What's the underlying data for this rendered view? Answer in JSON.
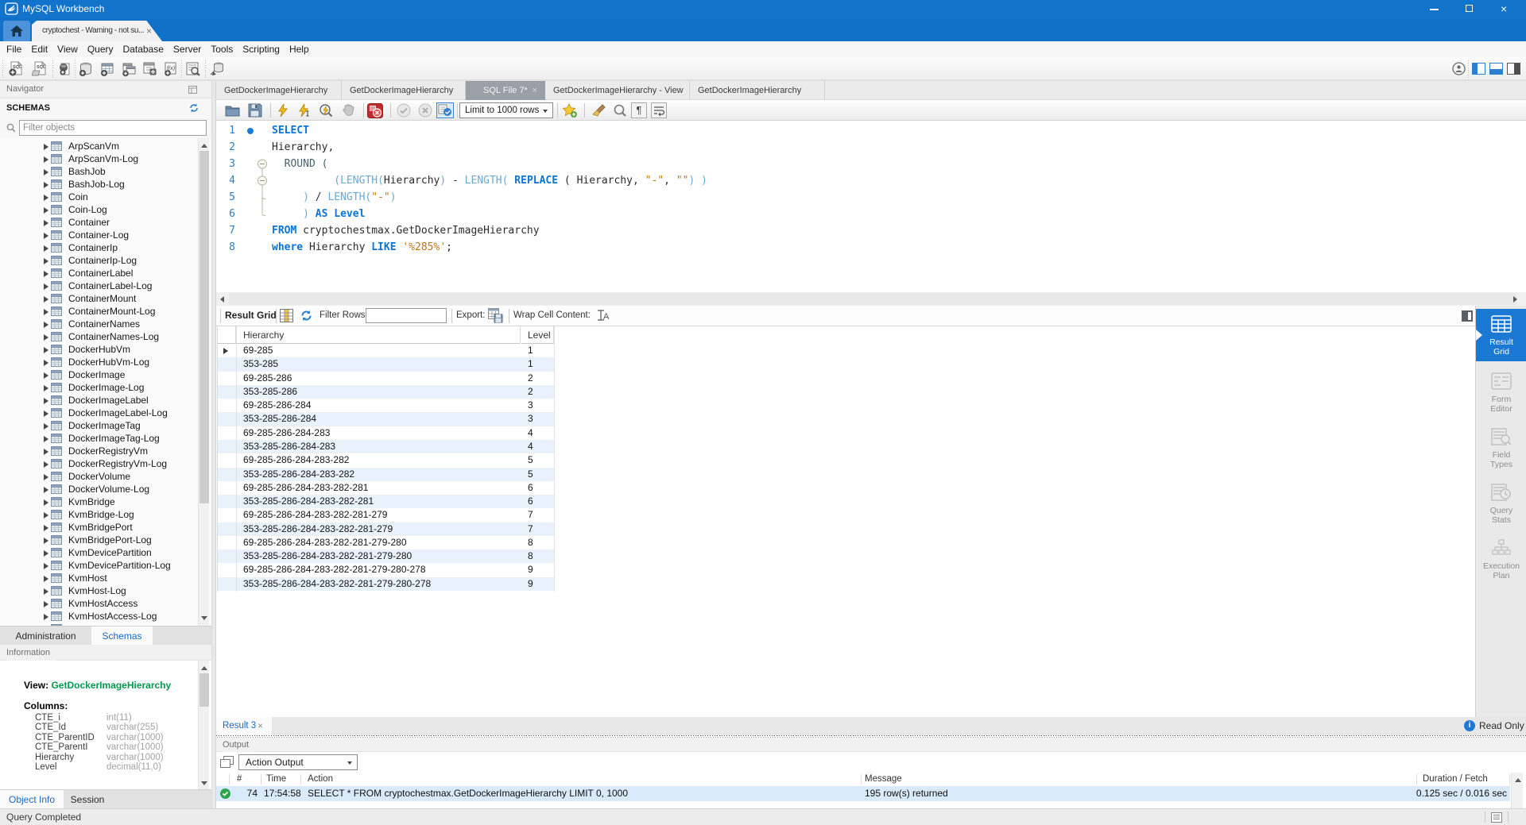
{
  "titlebar": {
    "title": "MySQL Workbench"
  },
  "doc_tab": {
    "label": "cryptochest - Warning - not su...",
    "close": "×"
  },
  "menu": {
    "items": [
      "File",
      "Edit",
      "View",
      "Query",
      "Database",
      "Server",
      "Tools",
      "Scripting",
      "Help"
    ]
  },
  "main_toolbar": {
    "icons": [
      "new-sql-tab",
      "open-sql-script",
      "new-model",
      "create-schema",
      "create-table",
      "create-view",
      "create-procedure",
      "create-function",
      "search-objects",
      "reconnect-database"
    ]
  },
  "navigator": {
    "title": "Navigator",
    "section": "SCHEMAS",
    "filter_placeholder": "Filter objects",
    "tree": [
      "ArpScanVm",
      "ArpScanVm-Log",
      "BashJob",
      "BashJob-Log",
      "Coin",
      "Coin-Log",
      "Container",
      "Container-Log",
      "ContainerIp",
      "ContainerIp-Log",
      "ContainerLabel",
      "ContainerLabel-Log",
      "ContainerMount",
      "ContainerMount-Log",
      "ContainerNames",
      "ContainerNames-Log",
      "DockerHubVm",
      "DockerHubVm-Log",
      "DockerImage",
      "DockerImage-Log",
      "DockerImageLabel",
      "DockerImageLabel-Log",
      "DockerImageTag",
      "DockerImageTag-Log",
      "DockerRegistryVm",
      "DockerRegistryVm-Log",
      "DockerVolume",
      "DockerVolume-Log",
      "KvmBridge",
      "KvmBridge-Log",
      "KvmBridgePort",
      "KvmBridgePort-Log",
      "KvmDevicePartition",
      "KvmDevicePartition-Log",
      "KvmHost",
      "KvmHost-Log",
      "KvmHostAccess",
      "KvmHostAccess-Log"
    ],
    "tabs": {
      "administration": "Administration",
      "schemas": "Schemas"
    }
  },
  "information": {
    "title": "Information",
    "view_label": "View:",
    "view_name": "GetDockerImageHierarchy",
    "columns_label": "Columns:",
    "columns": [
      {
        "name": "CTE_i",
        "type": "int(11)"
      },
      {
        "name": "CTE_Id",
        "type": "varchar(255)"
      },
      {
        "name": "CTE_ParentID",
        "type": "varchar(1000)"
      },
      {
        "name": "CTE_ParentI",
        "type": "varchar(1000)"
      },
      {
        "name": "Hierarchy",
        "type": "varchar(1000)"
      },
      {
        "name": "Level",
        "type": "decimal(11,0)"
      }
    ],
    "tabs": {
      "object_info": "Object Info",
      "session": "Session"
    }
  },
  "editor": {
    "tabs": [
      {
        "label": "GetDockerImageHierarchy",
        "active": false
      },
      {
        "label": "GetDockerImageHierarchy",
        "active": false
      },
      {
        "label": "SQL File 7*",
        "active": true
      },
      {
        "label": "GetDockerImageHierarchy - View",
        "active": false
      },
      {
        "label": "GetDockerImageHierarchy",
        "active": false
      }
    ],
    "toolbar": {
      "limit_label": "Limit to 1000 rows"
    },
    "code_lines": [
      {
        "n": "1",
        "tokens": [
          [
            "k",
            "SELECT"
          ]
        ]
      },
      {
        "n": "2",
        "tokens": [
          [
            "p",
            "Hierarchy,"
          ]
        ]
      },
      {
        "n": "3",
        "tokens": [
          [
            "p",
            "  "
          ],
          [
            "d",
            "ROUND ("
          ]
        ]
      },
      {
        "n": "4",
        "tokens": [
          [
            "p",
            "          "
          ],
          [
            "f",
            "(LENGTH("
          ],
          [
            "p",
            "Hierarchy"
          ],
          [
            "f",
            ")"
          ],
          [
            "p",
            " - "
          ],
          [
            "f",
            "LENGTH("
          ],
          [
            "p",
            " "
          ],
          [
            "k",
            "REPLACE"
          ],
          [
            "p",
            " ( Hierarchy, "
          ],
          [
            "s",
            "\"-\""
          ],
          [
            "p",
            ", "
          ],
          [
            "s",
            "\"\""
          ],
          [
            "f",
            ")"
          ],
          [
            "p",
            " "
          ],
          [
            "f",
            ")"
          ]
        ]
      },
      {
        "n": "5",
        "tokens": [
          [
            "p",
            "     "
          ],
          [
            "f",
            ")"
          ],
          [
            "p",
            " / "
          ],
          [
            "f",
            "LENGTH("
          ],
          [
            "s",
            "\"-\""
          ],
          [
            "f",
            ")"
          ]
        ]
      },
      {
        "n": "6",
        "tokens": [
          [
            "p",
            "     "
          ],
          [
            "f",
            ")"
          ],
          [
            "p",
            " "
          ],
          [
            "k",
            "AS Level"
          ]
        ]
      },
      {
        "n": "7",
        "tokens": [
          [
            "k",
            "FROM"
          ],
          [
            "p",
            " cryptochestmax.GetDockerImageHierarchy"
          ]
        ]
      },
      {
        "n": "8",
        "tokens": [
          [
            "k",
            "where"
          ],
          [
            "p",
            " Hierarchy "
          ],
          [
            "k",
            "LIKE"
          ],
          [
            "p",
            " "
          ],
          [
            "s",
            "'%285%'"
          ],
          [
            "p",
            ";"
          ]
        ]
      }
    ]
  },
  "result": {
    "toolbar": {
      "title": "Result Grid",
      "filter_label": "Filter Rows:",
      "filter_value": "",
      "export_label": "Export:",
      "wrap_label": "Wrap Cell Content:"
    },
    "grid": {
      "columns": [
        "Hierarchy",
        "Level"
      ],
      "rows": [
        [
          "69-285",
          "1"
        ],
        [
          "353-285",
          "1"
        ],
        [
          "69-285-286",
          "2"
        ],
        [
          "353-285-286",
          "2"
        ],
        [
          "69-285-286-284",
          "3"
        ],
        [
          "353-285-286-284",
          "3"
        ],
        [
          "69-285-286-284-283",
          "4"
        ],
        [
          "353-285-286-284-283",
          "4"
        ],
        [
          "69-285-286-284-283-282",
          "5"
        ],
        [
          "353-285-286-284-283-282",
          "5"
        ],
        [
          "69-285-286-284-283-282-281",
          "6"
        ],
        [
          "353-285-286-284-283-282-281",
          "6"
        ],
        [
          "69-285-286-284-283-282-281-279",
          "7"
        ],
        [
          "353-285-286-284-283-282-281-279",
          "7"
        ],
        [
          "69-285-286-284-283-282-281-279-280",
          "8"
        ],
        [
          "353-285-286-284-283-282-281-279-280",
          "8"
        ],
        [
          "69-285-286-284-283-282-281-279-280-278",
          "9"
        ],
        [
          "353-285-286-284-283-282-281-279-280-278",
          "9"
        ]
      ]
    },
    "side_buttons": [
      "Result Grid",
      "Form Editor",
      "Field Types",
      "Query Stats",
      "Execution Plan"
    ],
    "tab_label": "Result 3",
    "read_only": "Read Only"
  },
  "output": {
    "title": "Output",
    "selector": "Action Output",
    "columns": [
      "#",
      "Time",
      "Action",
      "Message",
      "Duration / Fetch"
    ],
    "rows": [
      {
        "num": "74",
        "time": "17:54:58",
        "action": "SELECT * FROM cryptochestmax.GetDockerImageHierarchy LIMIT 0, 1000",
        "message": "195 row(s) returned",
        "duration": "0.125 sec / 0.016 sec"
      }
    ]
  },
  "status_bar": {
    "text": "Query Completed"
  }
}
